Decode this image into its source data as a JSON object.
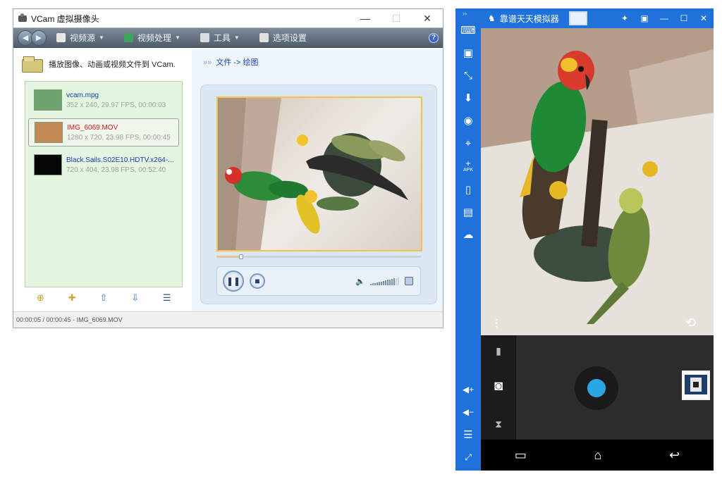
{
  "vcam": {
    "title": "VCam 虚拟摄像头",
    "window_controls": {
      "minimize": "—",
      "maximize": "☐",
      "close": "✕"
    },
    "menu": [
      {
        "label": "视频源",
        "icon": "document-icon",
        "color": "#e8e8e8"
      },
      {
        "label": "视频处理",
        "icon": "color-palette-icon",
        "color": "#3fa35b"
      },
      {
        "label": "工具",
        "icon": "pen-icon",
        "color": "#d8dde2"
      },
      {
        "label": "选项设置",
        "icon": "tools-icon",
        "color": "#e0e0e0"
      }
    ],
    "play_hint": "播放图像、动画或视频文件到 VCam.",
    "breadcrumb": "文件 -> 绘图",
    "files": [
      {
        "name": "vcam.mpg",
        "meta": "352 x 240, 29.97 FPS, 00:00:03",
        "selected": false,
        "highlight": false,
        "thumb_color": "#6ea36e"
      },
      {
        "name": "IMG_6069.MOV",
        "meta": "1280 x 720, 23.98 FPS, 00:00:45",
        "selected": true,
        "highlight": true,
        "thumb_color": "#c48a55"
      },
      {
        "name": "Black.Sails.S02E10.HDTV.x264-...",
        "meta": "720 x 404, 23.98 FPS, 00:52:40",
        "selected": false,
        "highlight": false,
        "thumb_color": "#050505"
      }
    ],
    "list_tools": [
      "add-file-icon",
      "add-folder-icon",
      "move-up-icon",
      "move-down-icon",
      "list-menu-icon"
    ],
    "playback": {
      "progress": 0.12,
      "volume": 0.8
    },
    "status": "00:00:05 / 00:00:45 - IMG_6069.MOV"
  },
  "emulator": {
    "title": "靠谱天天模拟器",
    "accent": "#1f72d9",
    "sidebar_icons": [
      "keyboard-icon",
      "screenshot-icon",
      "resize-icon",
      "install-icon",
      "camera-search-icon",
      "location-icon",
      "apk-icon",
      "shake-icon",
      "folder-share-icon",
      "network-icon"
    ],
    "apk_label": "APK",
    "shutter_color": "#2aa7e0"
  }
}
